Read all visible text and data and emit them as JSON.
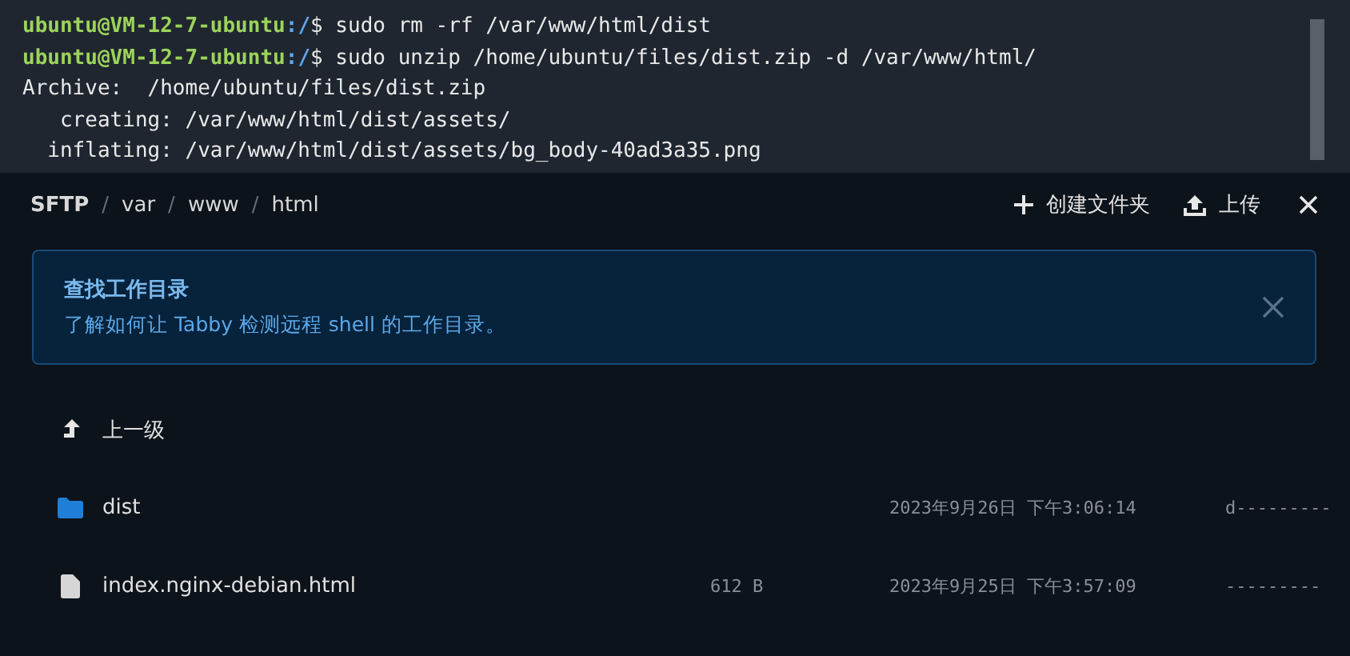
{
  "terminal": {
    "lines": [
      {
        "kind": "prompt",
        "user": "ubuntu@VM-12-7-ubuntu",
        "path": ":/",
        "symbol": "$",
        "command": "sudo rm -rf /var/www/html/dist"
      },
      {
        "kind": "prompt",
        "user": "ubuntu@VM-12-7-ubuntu",
        "path": ":/",
        "symbol": "$",
        "command": "sudo unzip /home/ubuntu/files/dist.zip -d /var/www/html/"
      },
      {
        "kind": "output",
        "text": "Archive:  /home/ubuntu/files/dist.zip"
      },
      {
        "kind": "output",
        "text": "   creating: /var/www/html/dist/assets/"
      },
      {
        "kind": "output",
        "text": "  inflating: /var/www/html/dist/assets/bg_body-40ad3a35.png"
      }
    ]
  },
  "sftp": {
    "breadcrumbs": [
      "SFTP",
      "var",
      "www",
      "html"
    ],
    "separator": "/",
    "actions": [
      {
        "kind": "new-folder",
        "label": "创建文件夹"
      },
      {
        "kind": "upload",
        "label": "上传"
      },
      {
        "kind": "close"
      }
    ],
    "alert": {
      "title": "查找工作目录",
      "text": "了解如何让 Tabby 检测远程 shell 的工作目录。"
    },
    "entries": [
      {
        "kind": "up",
        "name": "上一级"
      },
      {
        "kind": "folder",
        "name": "dist",
        "date": "2023年9月26日 下午3:06:14",
        "mode": "d---------"
      },
      {
        "kind": "file",
        "name": "index.nginx-debian.html",
        "size": "612 B",
        "date": "2023年9月25日 下午3:57:09",
        "mode": "---------"
      }
    ]
  }
}
